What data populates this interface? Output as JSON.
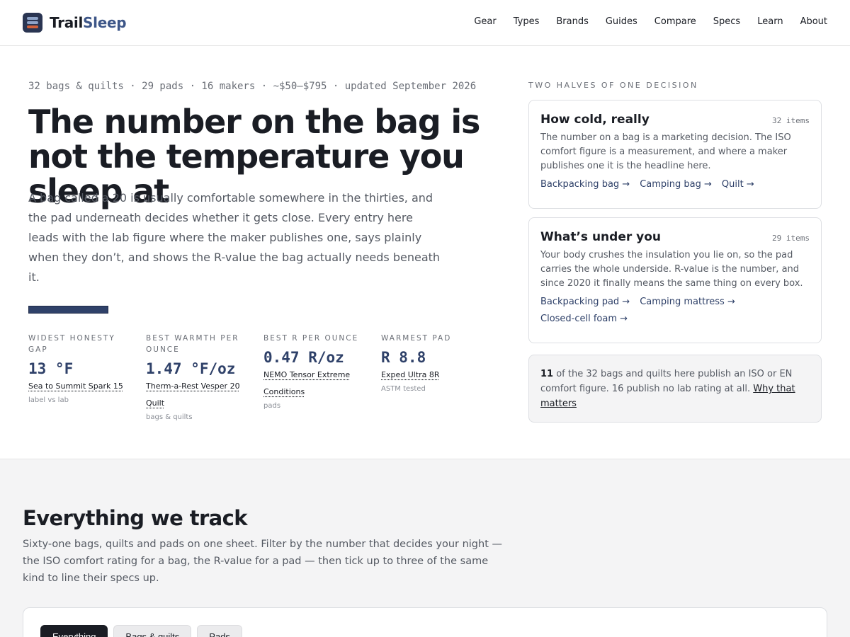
{
  "brand": {
    "part1": "Trail",
    "part2": "Sleep"
  },
  "nav": [
    "Gear",
    "Types",
    "Brands",
    "Guides",
    "Compare",
    "Specs",
    "Learn",
    "About"
  ],
  "hero": {
    "meta": "32 bags & quilts · 29 pads · 16 makers · ~$50–$795 · updated September 2026",
    "title": "The number on the bag is not the temperature you sleep at",
    "lede": "A bag called a 20 is usually comfortable somewhere in the thirties, and the pad underneath decides whether it gets close. Every entry here leads with the lab figure where the maker publishes one, says plainly when they don’t, and shows the R-value the bag actually needs beneath it."
  },
  "stats": [
    {
      "label": "Widest honesty gap",
      "value": "13 °F",
      "link": "Sea to Summit Spark 15",
      "note": "label vs lab"
    },
    {
      "label": "Best warmth per ounce",
      "value": "1.47 °F/oz",
      "link": "Therm-a-Rest Vesper 20 Quilt",
      "note": "bags & quilts"
    },
    {
      "label": "Best R per ounce",
      "value": "0.47 R/oz",
      "link": "NEMO Tensor Extreme Conditions",
      "note": "pads"
    },
    {
      "label": "Warmest pad",
      "value": "R 8.8",
      "link": "Exped Ultra 8R",
      "note": "ASTM tested"
    }
  ],
  "side": {
    "label": "Two halves of one decision",
    "cards": [
      {
        "title": "How cold, really",
        "count": "32 items",
        "desc": "The number on a bag is a marketing decision. The ISO comfort figure is a measurement, and where a maker publishes one it is the headline here.",
        "links": [
          "Backpacking bag →",
          "Camping bag →",
          "Quilt →"
        ]
      },
      {
        "title": "What’s under you",
        "count": "29 items",
        "desc": "Your body crushes the insulation you lie on, so the pad carries the whole underside. R-value is the number, and since 2020 it finally means the same thing on every box.",
        "links": [
          "Backpacking pad →",
          "Camping mattress →",
          "Closed-cell foam →"
        ]
      }
    ],
    "note": {
      "count": "11",
      "text": " of the 32 bags and quilts here publish an ISO or EN comfort figure. 16 publish no lab rating at all. ",
      "link": "Why that matters"
    }
  },
  "lower": {
    "title": "Everything we track",
    "desc": "Sixty-one bags, quilts and pads on one sheet. Filter by the number that decides your night — the ISO comfort rating for a bag, the R-value for a pad — then tick up to three of the same kind to line their specs up.",
    "tabs": [
      "Everything",
      "Bags & quilts",
      "Pads"
    ]
  }
}
